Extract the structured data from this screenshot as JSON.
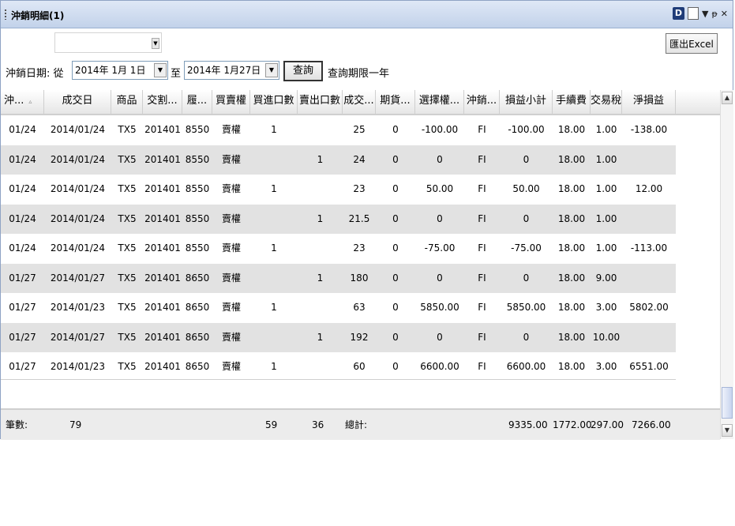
{
  "window": {
    "title": "沖銷明細(1)",
    "d_icon": "D",
    "pin_glyph": "▾ 𝟰 ×"
  },
  "toolbar": {
    "export_label": "匯出Excel"
  },
  "filter": {
    "date_label": "沖銷日期: 從",
    "from_date": "2014年 1月 1日",
    "to_label": "至",
    "to_date": "2014年 1月27日",
    "query_label": "查詢",
    "hint": "查詢期限一年"
  },
  "columns": [
    "沖...",
    "成交日",
    "商品",
    "交割...",
    "履...",
    "買賣權",
    "買進口數",
    "賣出口數",
    "成交...",
    "期貨...",
    "選擇權...",
    "沖銷...",
    "損益小計",
    "手續費",
    "交易稅",
    "淨損益"
  ],
  "rows": [
    [
      "01/24",
      "2014/01/24",
      "TX5",
      "201401",
      "8550",
      "賣權",
      "1",
      "",
      "25",
      "0",
      "-100.00",
      "FI",
      "-100.00",
      "18.00",
      "1.00",
      "-138.00"
    ],
    [
      "01/24",
      "2014/01/24",
      "TX5",
      "201401",
      "8550",
      "賣權",
      "",
      "1",
      "24",
      "0",
      "0",
      "FI",
      "0",
      "18.00",
      "1.00",
      ""
    ],
    [
      "01/24",
      "2014/01/24",
      "TX5",
      "201401",
      "8550",
      "賣權",
      "1",
      "",
      "23",
      "0",
      "50.00",
      "FI",
      "50.00",
      "18.00",
      "1.00",
      "12.00"
    ],
    [
      "01/24",
      "2014/01/24",
      "TX5",
      "201401",
      "8550",
      "賣權",
      "",
      "1",
      "21.5",
      "0",
      "0",
      "FI",
      "0",
      "18.00",
      "1.00",
      ""
    ],
    [
      "01/24",
      "2014/01/24",
      "TX5",
      "201401",
      "8550",
      "賣權",
      "1",
      "",
      "23",
      "0",
      "-75.00",
      "FI",
      "-75.00",
      "18.00",
      "1.00",
      "-113.00"
    ],
    [
      "01/27",
      "2014/01/27",
      "TX5",
      "201401",
      "8650",
      "賣權",
      "",
      "1",
      "180",
      "0",
      "0",
      "FI",
      "0",
      "18.00",
      "9.00",
      ""
    ],
    [
      "01/27",
      "2014/01/23",
      "TX5",
      "201401",
      "8650",
      "賣權",
      "1",
      "",
      "63",
      "0",
      "5850.00",
      "FI",
      "5850.00",
      "18.00",
      "3.00",
      "5802.00"
    ],
    [
      "01/27",
      "2014/01/27",
      "TX5",
      "201401",
      "8650",
      "賣權",
      "",
      "1",
      "192",
      "0",
      "0",
      "FI",
      "0",
      "18.00",
      "10.00",
      ""
    ],
    [
      "01/27",
      "2014/01/23",
      "TX5",
      "201401",
      "8650",
      "賣權",
      "1",
      "",
      "60",
      "0",
      "6600.00",
      "FI",
      "6600.00",
      "18.00",
      "3.00",
      "6551.00"
    ]
  ],
  "footer": {
    "count_label": "筆數:",
    "count": "79",
    "buy_total": "59",
    "sell_total": "36",
    "total_label": "總計:",
    "pnl_subtotal": "9335.00",
    "fee_total": "1772.00",
    "tax_total": "297.00",
    "net_total": "7266.00"
  }
}
